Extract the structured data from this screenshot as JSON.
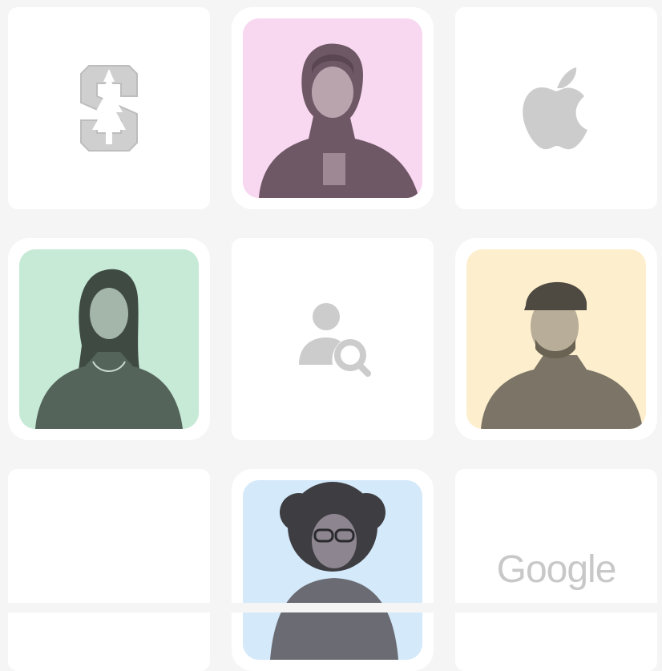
{
  "cards": [
    {
      "type": "logo",
      "icon": "stanford-logo-icon"
    },
    {
      "type": "person",
      "bg": "#f8d7f0",
      "description_icon": "person-hoodie-photo"
    },
    {
      "type": "logo",
      "icon": "apple-logo-icon"
    },
    {
      "type": "person",
      "bg": "#c6ead6",
      "description_icon": "person-woman-photo"
    },
    {
      "type": "icon",
      "icon": "user-search-icon"
    },
    {
      "type": "person",
      "bg": "#fdefcd",
      "description_icon": "person-cap-photo"
    },
    {
      "type": "empty"
    },
    {
      "type": "person",
      "bg": "#d4e9fa",
      "description_icon": "person-curly-photo"
    },
    {
      "type": "logo",
      "icon": "google-logo-icon",
      "label": "Google"
    }
  ],
  "colors": {
    "page_bg": "#f5f5f5",
    "card_bg": "#ffffff",
    "logo_gray": "#c8c8c8"
  }
}
